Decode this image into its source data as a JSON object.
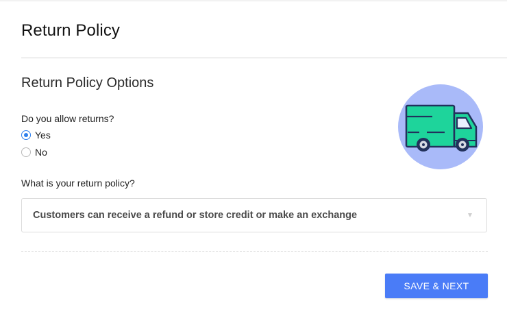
{
  "header": {
    "title": "Return Policy"
  },
  "section": {
    "title": "Return Policy Options"
  },
  "returns_question": {
    "label": "Do you allow returns?",
    "options": [
      {
        "label": "Yes",
        "selected": true
      },
      {
        "label": "No",
        "selected": false
      }
    ]
  },
  "policy_question": {
    "label": "What is your return policy?",
    "selected_value": "Customers can receive a refund or store credit or make an exchange"
  },
  "actions": {
    "save_next_label": "SAVE & NEXT"
  },
  "illustration": {
    "icon": "delivery-truck-icon",
    "circle_color": "#a9baf9",
    "truck_color": "#1ed49b"
  },
  "colors": {
    "accent": "#4a7cf7",
    "radio_checked": "#2f80ed"
  }
}
